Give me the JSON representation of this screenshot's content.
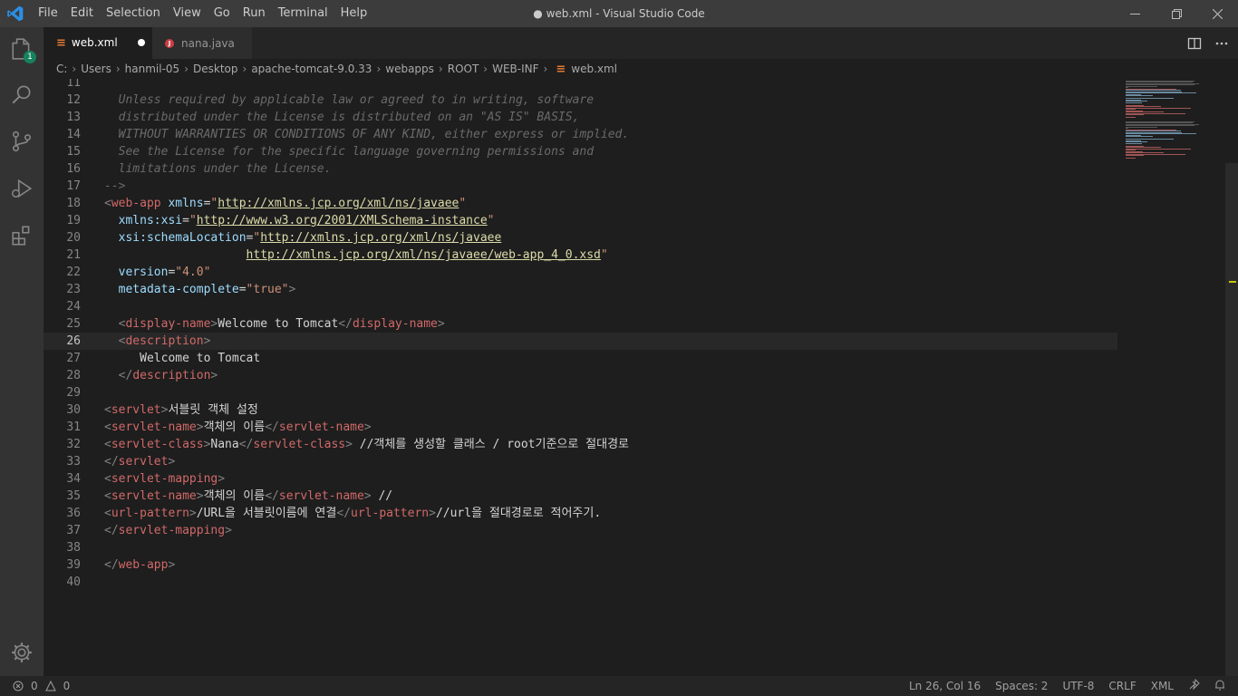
{
  "window": {
    "title": "● web.xml - Visual Studio Code"
  },
  "menu": [
    "File",
    "Edit",
    "Selection",
    "View",
    "Go",
    "Run",
    "Terminal",
    "Help"
  ],
  "activity": {
    "explorer_badge": "1"
  },
  "tabs": [
    {
      "label": "web.xml",
      "active": true,
      "dirty": true,
      "icon": "xml-file-icon"
    },
    {
      "label": "nana.java",
      "active": false,
      "dirty": false,
      "icon": "java-file-icon"
    }
  ],
  "breadcrumb": [
    "C:",
    "Users",
    "hanmil-05",
    "Desktop",
    "apache-tomcat-9.0.33",
    "webapps",
    "ROOT",
    "WEB-INF",
    "web.xml"
  ],
  "editor": {
    "current_line": 26,
    "lines": [
      {
        "n": "11",
        "tokens": []
      },
      {
        "n": "12",
        "tokens": [
          [
            "c",
            "  Unless required by applicable law or agreed to in writing, software"
          ]
        ]
      },
      {
        "n": "13",
        "tokens": [
          [
            "c",
            "  distributed under the License is distributed on an \"AS IS\" BASIS,"
          ]
        ]
      },
      {
        "n": "14",
        "tokens": [
          [
            "c",
            "  WITHOUT WARRANTIES OR CONDITIONS OF ANY KIND, either express or implied."
          ]
        ]
      },
      {
        "n": "15",
        "tokens": [
          [
            "c",
            "  See the License for the specific language governing permissions and"
          ]
        ]
      },
      {
        "n": "16",
        "tokens": [
          [
            "c",
            "  limitations under the License."
          ]
        ]
      },
      {
        "n": "17",
        "tokens": [
          [
            "c",
            "-->"
          ]
        ]
      },
      {
        "n": "18",
        "tokens": [
          [
            "b",
            "<"
          ],
          [
            "t",
            "web-app"
          ],
          [
            "x",
            " "
          ],
          [
            "a",
            "xmlns"
          ],
          [
            "x",
            "="
          ],
          [
            "s",
            "\""
          ],
          [
            "u",
            "http://xmlns.jcp.org/xml/ns/javaee"
          ],
          [
            "s",
            "\""
          ]
        ]
      },
      {
        "n": "19",
        "tokens": [
          [
            "x",
            "  "
          ],
          [
            "a",
            "xmlns:xsi"
          ],
          [
            "x",
            "="
          ],
          [
            "s",
            "\""
          ],
          [
            "u",
            "http://www.w3.org/2001/XMLSchema-instance"
          ],
          [
            "s",
            "\""
          ]
        ]
      },
      {
        "n": "20",
        "tokens": [
          [
            "x",
            "  "
          ],
          [
            "a",
            "xsi:schemaLocation"
          ],
          [
            "x",
            "="
          ],
          [
            "s",
            "\""
          ],
          [
            "u",
            "http://xmlns.jcp.org/xml/ns/javaee"
          ]
        ]
      },
      {
        "n": "21",
        "tokens": [
          [
            "x",
            "                    "
          ],
          [
            "u",
            "http://xmlns.jcp.org/xml/ns/javaee/web-app_4_0.xsd"
          ],
          [
            "s",
            "\""
          ]
        ]
      },
      {
        "n": "22",
        "tokens": [
          [
            "x",
            "  "
          ],
          [
            "a",
            "version"
          ],
          [
            "x",
            "="
          ],
          [
            "s",
            "\"4.0\""
          ]
        ]
      },
      {
        "n": "23",
        "tokens": [
          [
            "x",
            "  "
          ],
          [
            "a",
            "metadata-complete"
          ],
          [
            "x",
            "="
          ],
          [
            "s",
            "\"true\""
          ],
          [
            "b",
            ">"
          ]
        ]
      },
      {
        "n": "24",
        "tokens": []
      },
      {
        "n": "25",
        "tokens": [
          [
            "x",
            "  "
          ],
          [
            "b",
            "<"
          ],
          [
            "t",
            "display-name"
          ],
          [
            "b",
            ">"
          ],
          [
            "x",
            "Welcome to Tomcat"
          ],
          [
            "b",
            "</"
          ],
          [
            "t",
            "display-name"
          ],
          [
            "b",
            ">"
          ]
        ]
      },
      {
        "n": "26",
        "tokens": [
          [
            "x",
            "  "
          ],
          [
            "b",
            "<"
          ],
          [
            "t",
            "description"
          ],
          [
            "b",
            ">"
          ]
        ]
      },
      {
        "n": "27",
        "tokens": [
          [
            "x",
            "     Welcome to Tomcat"
          ]
        ]
      },
      {
        "n": "28",
        "tokens": [
          [
            "x",
            "  "
          ],
          [
            "b",
            "</"
          ],
          [
            "t",
            "description"
          ],
          [
            "b",
            ">"
          ]
        ]
      },
      {
        "n": "29",
        "tokens": []
      },
      {
        "n": "30",
        "tokens": [
          [
            "b",
            "<"
          ],
          [
            "t",
            "servlet"
          ],
          [
            "b",
            ">"
          ],
          [
            "x",
            "서블릿 객체 설정"
          ]
        ]
      },
      {
        "n": "31",
        "tokens": [
          [
            "b",
            "<"
          ],
          [
            "t",
            "servlet-name"
          ],
          [
            "b",
            ">"
          ],
          [
            "x",
            "객체의 이름"
          ],
          [
            "b",
            "</"
          ],
          [
            "t",
            "servlet-name"
          ],
          [
            "b",
            ">"
          ]
        ]
      },
      {
        "n": "32",
        "tokens": [
          [
            "b",
            "<"
          ],
          [
            "t",
            "servlet-class"
          ],
          [
            "b",
            ">"
          ],
          [
            "x",
            "Nana"
          ],
          [
            "b",
            "</"
          ],
          [
            "t",
            "servlet-class"
          ],
          [
            "b",
            ">"
          ],
          [
            "x",
            " //객체를 생성할 클래스 / root기준으로 절대경로"
          ]
        ]
      },
      {
        "n": "33",
        "tokens": [
          [
            "b",
            "</"
          ],
          [
            "t",
            "servlet"
          ],
          [
            "b",
            ">"
          ]
        ]
      },
      {
        "n": "34",
        "tokens": [
          [
            "b",
            "<"
          ],
          [
            "t",
            "servlet-mapping"
          ],
          [
            "b",
            ">"
          ]
        ]
      },
      {
        "n": "35",
        "tokens": [
          [
            "b",
            "<"
          ],
          [
            "t",
            "servlet-name"
          ],
          [
            "b",
            ">"
          ],
          [
            "x",
            "객체의 이름"
          ],
          [
            "b",
            "</"
          ],
          [
            "t",
            "servlet-name"
          ],
          [
            "b",
            ">"
          ],
          [
            "x",
            " //"
          ]
        ]
      },
      {
        "n": "36",
        "tokens": [
          [
            "b",
            "<"
          ],
          [
            "t",
            "url-pattern"
          ],
          [
            "b",
            ">"
          ],
          [
            "x",
            "/URL을 서블릿이름에 연결"
          ],
          [
            "b",
            "</"
          ],
          [
            "t",
            "url-pattern"
          ],
          [
            "b",
            ">"
          ],
          [
            "x",
            "//url을 절대경로로 적어주기."
          ]
        ]
      },
      {
        "n": "37",
        "tokens": [
          [
            "b",
            "</"
          ],
          [
            "t",
            "servlet-mapping"
          ],
          [
            "b",
            ">"
          ]
        ]
      },
      {
        "n": "38",
        "tokens": []
      },
      {
        "n": "39",
        "tokens": [
          [
            "b",
            "</"
          ],
          [
            "t",
            "web-app"
          ],
          [
            "b",
            ">"
          ]
        ]
      },
      {
        "n": "40",
        "tokens": []
      }
    ]
  },
  "statusbar": {
    "errors": "0",
    "warnings": "0",
    "position": "Ln 26, Col 16",
    "spaces": "Spaces: 2",
    "encoding": "UTF-8",
    "eol": "CRLF",
    "language": "XML"
  },
  "colors": {
    "titlebar": "#3c3c3c",
    "activitybar": "#333333",
    "editor_bg": "#1e1e1e",
    "tag": "#d16969",
    "attribute": "#9cdcfe",
    "string": "#ce9178",
    "link": "#dcdcaa",
    "comment": "#6a6a6a"
  }
}
